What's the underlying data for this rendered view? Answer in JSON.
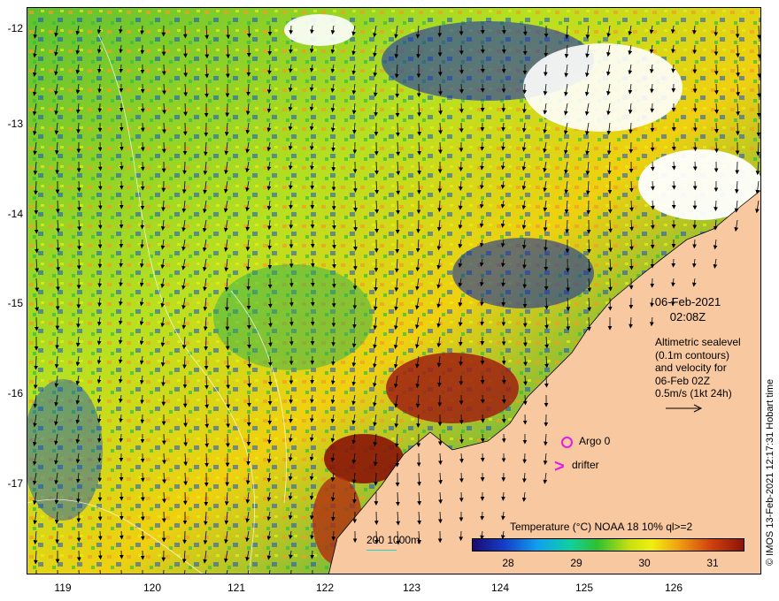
{
  "map": {
    "lat_ticks": [
      "-12",
      "-13",
      "-14",
      "-15",
      "-16",
      "-17"
    ],
    "lon_ticks": [
      "119",
      "120",
      "121",
      "122",
      "123",
      "124",
      "125",
      "126"
    ],
    "date": "06-Feb-2021",
    "time": "02:08Z",
    "info_lines": [
      "Altimetric sealevel",
      "(0.1m contours)",
      "and velocity for",
      "06-Feb 02Z",
      "0.5m/s (1kt 24h)"
    ],
    "argo_label": "Argo 0",
    "drifter_label": "drifter",
    "colorbar_title": "Temperature (°C) NOAA 18 10% ql>=2",
    "colorbar_ticks": [
      "28",
      "29",
      "30",
      "31"
    ],
    "scale_label": "200  1000m",
    "credit": "© IMOS 13-Feb-2021 12:17:31 Hobart time",
    "colors": {
      "land": "#f8c8a0",
      "cold": "#1a0a70",
      "warm": "#8a1408",
      "markers": "#e020e0",
      "isobath": "#2ad0c0"
    }
  }
}
